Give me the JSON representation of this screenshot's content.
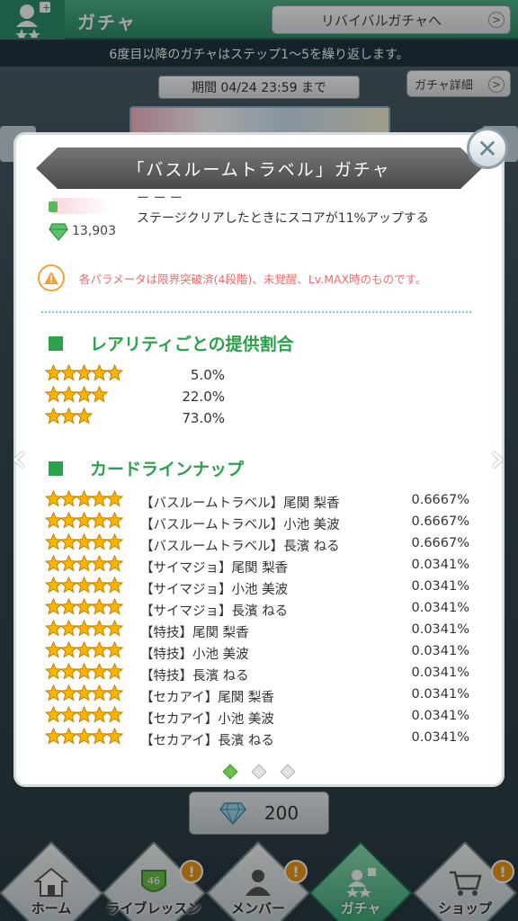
{
  "header": {
    "title": "ガチャ",
    "revival_button": "リバイバルガチャへ",
    "notice": "6度目以降のガチャはステップ1～5を繰り返します。",
    "period": "期間 04/24 23:59 まで",
    "detail_button": "ガチャ詳細"
  },
  "modal": {
    "title": "「バスルームトラベル」ガチャ",
    "skill_description": "ステージクリアしたときにスコアが11%アップする",
    "power_value": "13,903",
    "caution": "各パラメータは限界突破済(4段階)、未覚醒、Lv.MAX時のものです。",
    "rarity_section_title": "レアリティごとの提供割合",
    "lineup_section_title": "カードラインナップ",
    "rarity_rates": [
      {
        "stars": 5,
        "rate": "5.0%"
      },
      {
        "stars": 4,
        "rate": "22.0%"
      },
      {
        "stars": 3,
        "rate": "73.0%"
      }
    ],
    "lineup": [
      {
        "stars": 5,
        "name": "【バスルームトラベル】尾関 梨香",
        "rate": "0.6667%"
      },
      {
        "stars": 5,
        "name": "【バスルームトラベル】小池 美波",
        "rate": "0.6667%"
      },
      {
        "stars": 5,
        "name": "【バスルームトラベル】長濱 ねる",
        "rate": "0.6667%"
      },
      {
        "stars": 5,
        "name": "【サイマジョ】尾関 梨香",
        "rate": "0.0341%"
      },
      {
        "stars": 5,
        "name": "【サイマジョ】小池 美波",
        "rate": "0.0341%"
      },
      {
        "stars": 5,
        "name": "【サイマジョ】長濱 ねる",
        "rate": "0.0341%"
      },
      {
        "stars": 5,
        "name": "【特技】尾関 梨香",
        "rate": "0.0341%"
      },
      {
        "stars": 5,
        "name": "【特技】小池 美波",
        "rate": "0.0341%"
      },
      {
        "stars": 5,
        "name": "【特技】長濱 ねる",
        "rate": "0.0341%"
      },
      {
        "stars": 5,
        "name": "【セカアイ】尾関 梨香",
        "rate": "0.0341%"
      },
      {
        "stars": 5,
        "name": "【セカアイ】小池 美波",
        "rate": "0.0341%"
      },
      {
        "stars": 5,
        "name": "【セカアイ】長濱 ねる",
        "rate": "0.0341%"
      }
    ],
    "pager": {
      "pages": 3,
      "current": 1
    }
  },
  "price": {
    "icon": "diamond-icon",
    "value": "200"
  },
  "nav": [
    {
      "label": "ホーム",
      "icon": "home-icon",
      "alert": false,
      "active": false
    },
    {
      "label": "ライブレッスン",
      "icon": "lesson-icon",
      "alert": true,
      "active": false
    },
    {
      "label": "メンバー",
      "icon": "member-icon",
      "alert": true,
      "active": false
    },
    {
      "label": "ガチャ",
      "icon": "gacha-icon",
      "alert": false,
      "active": true
    },
    {
      "label": "ショップ",
      "icon": "shop-icon",
      "alert": true,
      "active": false
    }
  ],
  "colors": {
    "accent_green": "#2aa24a",
    "caution_red": "#f06a6a",
    "alert_orange": "#f29a1a",
    "star_gold": "#f7b500"
  }
}
